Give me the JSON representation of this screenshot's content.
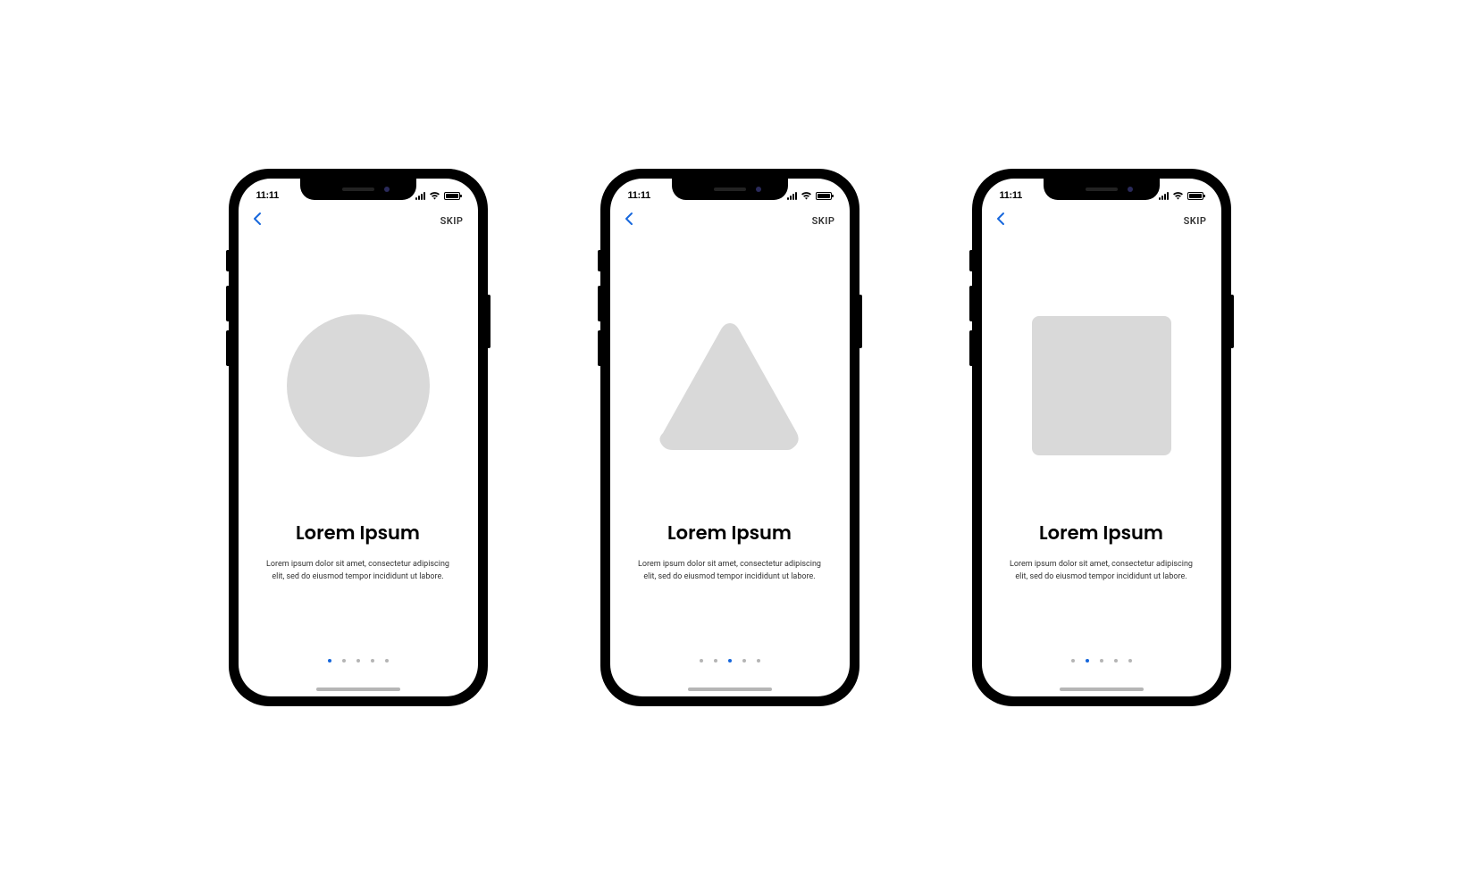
{
  "status": {
    "time": "11:11"
  },
  "nav": {
    "skip_label": "SKIP"
  },
  "colors": {
    "accent": "#1767dc",
    "shape_fill": "#d9d9d9",
    "dot_inactive": "#b5b5b5"
  },
  "screens": [
    {
      "shape": "circle",
      "title": "Lorem Ipsum",
      "description": "Lorem ipsum dolor sit amet, consectetur adipiscing elit, sed do eiusmod tempor incididunt ut labore.",
      "active_dot": 0,
      "total_dots": 5
    },
    {
      "shape": "triangle",
      "title": "Lorem Ipsum",
      "description": "Lorem ipsum dolor sit amet, consectetur adipiscing elit, sed do eiusmod tempor incididunt ut labore.",
      "active_dot": 2,
      "total_dots": 5
    },
    {
      "shape": "square",
      "title": "Lorem Ipsum",
      "description": "Lorem ipsum dolor sit amet, consectetur adipiscing elit, sed do eiusmod tempor incididunt ut labore.",
      "active_dot": 1,
      "total_dots": 5
    }
  ]
}
